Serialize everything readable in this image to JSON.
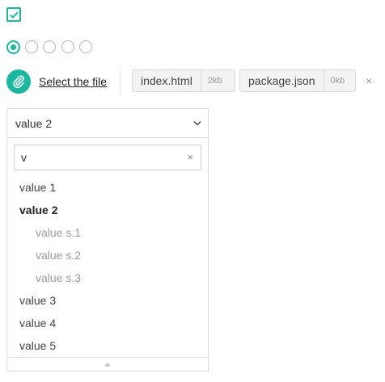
{
  "checkbox": {
    "checked": true,
    "icon": "check-icon"
  },
  "radios": {
    "count": 5,
    "selected_index": 0
  },
  "upload": {
    "select_label": "Select the file",
    "files": [
      {
        "name": "index.html",
        "size": "2kb"
      },
      {
        "name": "package.json",
        "size": "0kb"
      }
    ],
    "clear_symbol": "×"
  },
  "combo": {
    "value": "value 2",
    "search_value": "v",
    "search_clear": "×",
    "options": [
      {
        "label": "value 1",
        "level": 0,
        "selected": false
      },
      {
        "label": "value 2",
        "level": 0,
        "selected": true
      },
      {
        "label": "value s.1",
        "level": 1,
        "selected": false
      },
      {
        "label": "value s.2",
        "level": 1,
        "selected": false
      },
      {
        "label": "value s.3",
        "level": 1,
        "selected": false
      },
      {
        "label": "value 3",
        "level": 0,
        "selected": false
      },
      {
        "label": "value 4",
        "level": 0,
        "selected": false
      },
      {
        "label": "value 5",
        "level": 0,
        "selected": false
      }
    ]
  },
  "colors": {
    "accent": "#1ab99f",
    "border": "#d9d9d9",
    "muted_text": "#9a9a9a"
  }
}
